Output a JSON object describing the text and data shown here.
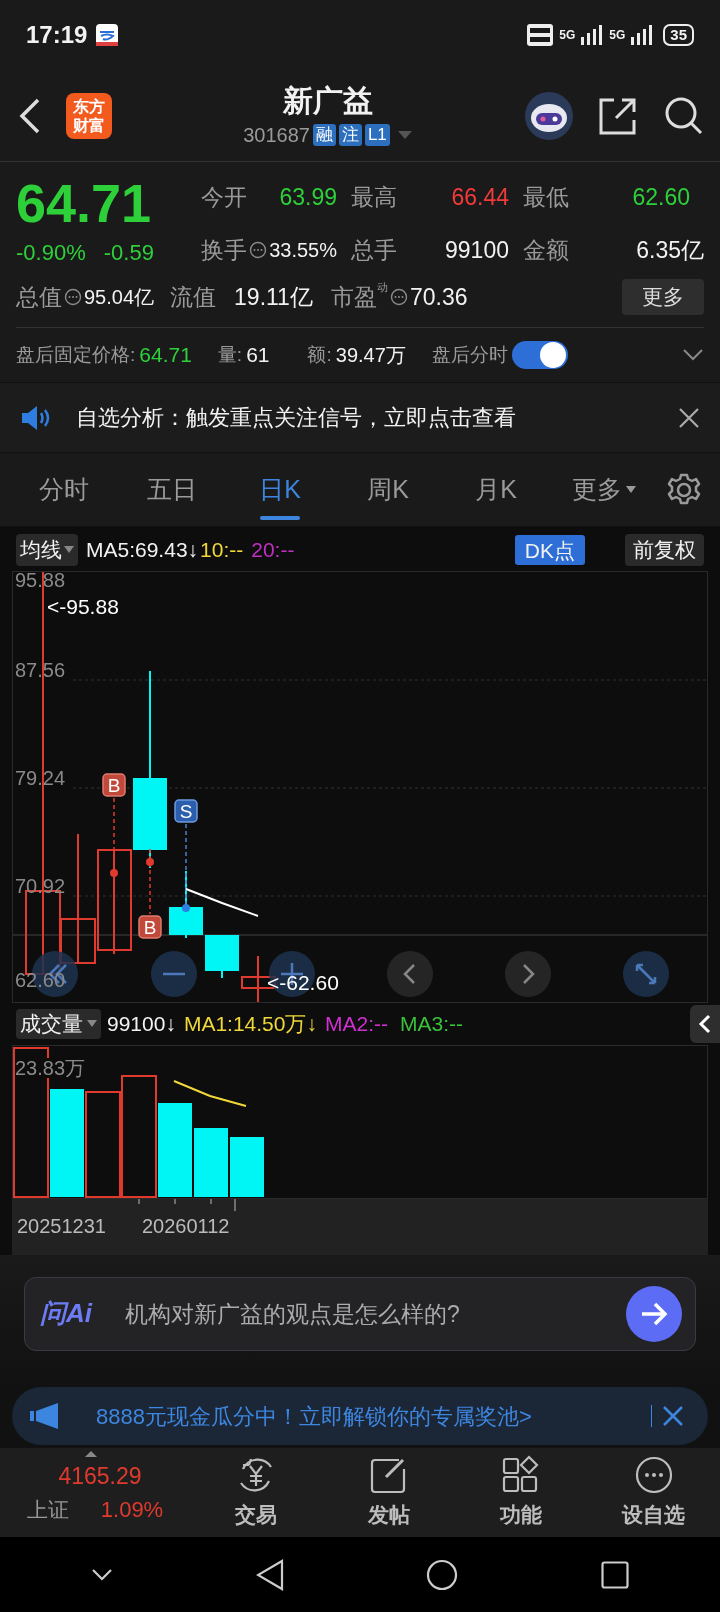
{
  "status_bar": {
    "time": "17:19",
    "network_1": "5G",
    "network_2": "5G",
    "battery": "35"
  },
  "header": {
    "logo": "东方财富",
    "title": "新广益",
    "code": "301687",
    "tags": [
      "融",
      "注",
      "L1"
    ]
  },
  "quote": {
    "price": "64.71",
    "change_pct": "-0.90%",
    "change": "-0.59",
    "stats": [
      {
        "label": "今开",
        "value": "63.99",
        "color": "#2ed03a",
        "info": false
      },
      {
        "label": "最高",
        "value": "66.44",
        "color": "#f23a3a",
        "info": false
      },
      {
        "label": "最低",
        "value": "62.60",
        "color": "#2ed03a",
        "info": false
      },
      {
        "label": "换手",
        "value": "33.55%",
        "color": "#f2f2f2",
        "info": true
      },
      {
        "label": "总手",
        "value": "99100",
        "color": "#f2f2f2",
        "info": false
      },
      {
        "label": "金额",
        "value": "6.35亿",
        "color": "#f2f2f2",
        "info": false
      }
    ],
    "total_value_label": "总值",
    "total_value": "95.04亿",
    "float_label": "流值",
    "float_value": "19.11亿",
    "pe_label": "市盈",
    "pe_sup": "动",
    "pe_value": "70.36",
    "more_button": "更多"
  },
  "after_hours": {
    "price_label": "盘后固定价格:",
    "price": "64.71",
    "volume_label": "量:",
    "volume": "61",
    "amount_label": "额:",
    "amount": "39.47万",
    "toggle_label": "盘后分时",
    "toggle_on": true
  },
  "notice": {
    "text": "自选分析：触发重点关注信号，立即点击查看"
  },
  "tabs": [
    {
      "label": "分时",
      "selected": false
    },
    {
      "label": "五日",
      "selected": false
    },
    {
      "label": "日K",
      "selected": true
    },
    {
      "label": "周K",
      "selected": false
    },
    {
      "label": "月K",
      "selected": false
    },
    {
      "label": "更多",
      "selected": false
    }
  ],
  "kline": {
    "indicator": "均线",
    "ma5": "MA5:69.43↓",
    "ma10": "10:--",
    "ma20": "20:--",
    "dk_button": "DK点",
    "adjust_button": "前复权",
    "axis_labels": [
      "95.88",
      "87.56",
      "79.24",
      "70.92",
      "62.60"
    ],
    "high_label": "<-95.88",
    "low_label": "<-62.60",
    "markers": [
      {
        "kind": "buy",
        "label": "B"
      },
      {
        "kind": "buy",
        "label": "B"
      },
      {
        "kind": "sell",
        "label": "S"
      }
    ]
  },
  "volume": {
    "indicator": "成交量",
    "current": "99100↓",
    "ma1": "MA1:14.50万↓",
    "ma2": "MA2:--",
    "ma3": "MA3:--",
    "max_label": "23.83万",
    "dates": [
      "20251231",
      "20260112"
    ]
  },
  "ai_box": {
    "brand": "问Ai",
    "placeholder": "机构对新广益的观点是怎么样的?"
  },
  "promo": {
    "text": "8888元现金瓜分中！立即解锁你的专属奖池>"
  },
  "bottom_nav": {
    "index_value": "4165.29",
    "index_name": "上证",
    "index_change": "1.09%",
    "items": [
      {
        "kind": "trade",
        "label": "交易"
      },
      {
        "kind": "post",
        "label": "发帖"
      },
      {
        "kind": "apps",
        "label": "功能"
      },
      {
        "kind": "more",
        "label": "设自选"
      }
    ]
  }
}
